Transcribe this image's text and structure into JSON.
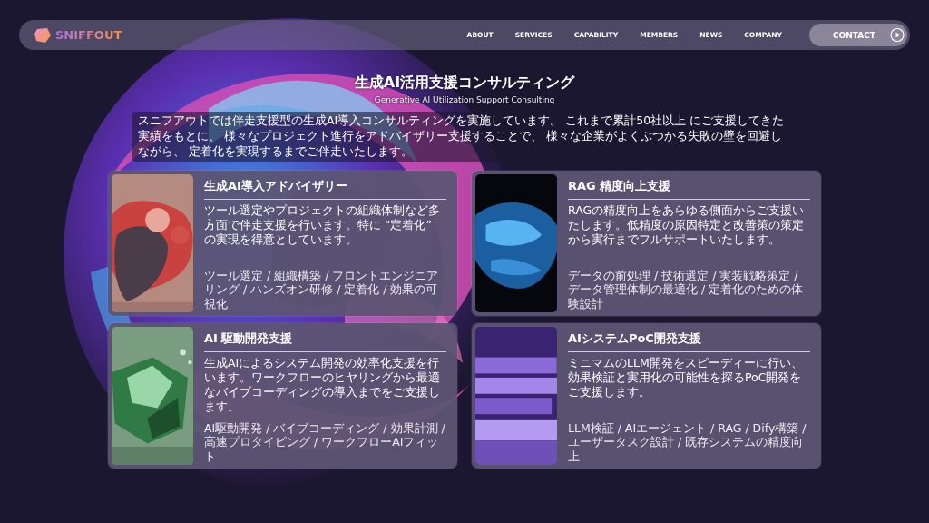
{
  "header": {
    "logo": "SNIFFOUT",
    "nav": [
      {
        "label": "ABOUT"
      },
      {
        "label": "SERVICES"
      },
      {
        "label": "CAPABILITY"
      },
      {
        "label": "MEMBERS"
      },
      {
        "label": "NEWS"
      },
      {
        "label": "COMPANY"
      }
    ],
    "contact": "CONTACT"
  },
  "hero": {
    "title": "生成AI活用支援コンサルティング",
    "subtitle": "Generative AI Utilization Support Consulting",
    "intro": "スニフアウトでは伴走支援型の生成AI導入コンサルティングを実施しています。 これまで累計50社以上 にご支援してきた実績をもとに、 様々なプロジェクト進行をアドバイザリー支援することで、 様々な企業がよくぶつかる失敗の壁を回避しながら、 定着化を実現するまでご伴走いたします。"
  },
  "services": [
    {
      "title": "生成AI導入アドバイザリー",
      "description": "ツール選定やプロジェクトの組織体制など多方面で伴走支援を行います。特に “定着化” の実現を得意としています。",
      "tags": "ツール選定 / 組織構築 / フロントエンジニアリング / ハンズオン研修 / 定着化 / 効果の可視化"
    },
    {
      "title": "RAG 精度向上支援",
      "description": "RAGの精度向上をあらゆる側面からご支援いたします。低精度の原因特定と改善策の策定から実行までフルサポートいたします。",
      "tags": "データの前処理 / 技術選定 / 実装戦略策定 / データ管理体制の最適化 / 定着化のための体験設計"
    },
    {
      "title": "AI 駆動開発支援",
      "description": "生成AIによるシステム開発の効率化支援を行います。ワークフローのヒヤリングから最適なバイブコーディングの導入までをご支援します。",
      "tags": "AI駆動開発 / バイブコーディング / 効果計測 / 高速プロタイピング / ワークフローAIフィット"
    },
    {
      "title": "AIシステムPoC開発支援",
      "description": "ミニマムのLLM開発をスピーディーに行い、効果検証と実用化の可能性を探るPoC開発をご支援します。",
      "tags": "LLM検証 / AIエージェント / RAG / Dify構築 / ユーザータスク設計 / 既存システムの精度向上"
    }
  ]
}
